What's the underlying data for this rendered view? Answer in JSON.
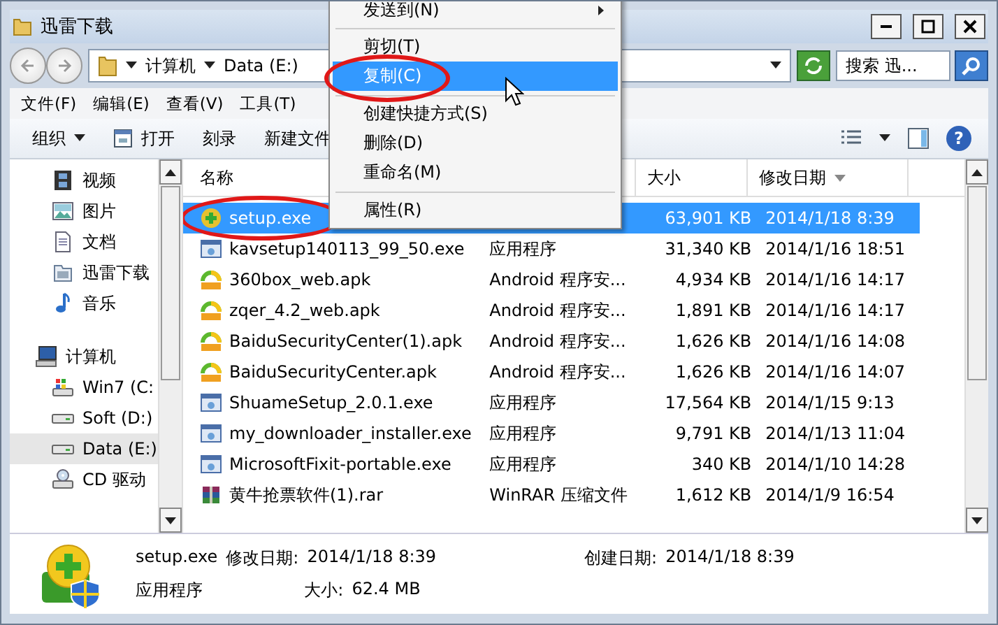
{
  "window": {
    "title": "迅雷下载"
  },
  "address_bar": {
    "path": [
      "计算机",
      "Data (E:)"
    ]
  },
  "search": {
    "placeholder": "搜索 迅..."
  },
  "menu_bar": [
    "文件(F)",
    "编辑(E)",
    "查看(V)",
    "工具(T)"
  ],
  "toolbar": [
    {
      "label": "组织",
      "kind": "dropdown"
    },
    {
      "label": "打开",
      "kind": "open"
    },
    {
      "label": "刻录",
      "kind": "plain"
    },
    {
      "label": "新建文件",
      "kind": "plain"
    }
  ],
  "help_button": {
    "label": "?"
  },
  "sidebar": {
    "items": [
      {
        "label": "视频",
        "kind": "video",
        "selected": false
      },
      {
        "label": "图片",
        "kind": "picture",
        "selected": false
      },
      {
        "label": "文档",
        "kind": "document",
        "selected": false
      },
      {
        "label": "迅雷下载",
        "kind": "folder",
        "selected": false
      },
      {
        "label": "音乐",
        "kind": "music",
        "selected": false
      },
      {
        "label": "计算机",
        "kind": "computer",
        "selected": false,
        "children": [
          {
            "label": "Win7 (C:",
            "kind": "system-drive",
            "selected": false
          },
          {
            "label": "Soft (D:)",
            "kind": "drive",
            "selected": false
          },
          {
            "label": "Data (E:)",
            "kind": "drive",
            "selected": true
          },
          {
            "label": "CD 驱动",
            "kind": "cd",
            "selected": false
          }
        ]
      }
    ]
  },
  "file_list": {
    "columns": [
      {
        "label": "名称",
        "sorted": false
      },
      {
        "label": "大小",
        "sorted": false
      },
      {
        "label": "修改日期",
        "sorted": true
      }
    ],
    "rows": [
      {
        "name": "setup.exe",
        "size": "63,901 KB",
        "modified": "2014/1/18 8:39",
        "kind": "setup",
        "selected": true,
        "highlighted": true
      },
      {
        "name": "kavsetup140113_99_50.exe",
        "type": "应用程序",
        "size": "31,340 KB",
        "modified": "2014/1/16 18:51",
        "kind": "exe",
        "selected": false,
        "highlighted": false
      },
      {
        "name": "360box_web.apk",
        "type": "Android 程序安...",
        "size": "4,934 KB",
        "modified": "2014/1/16 14:17",
        "kind": "apk",
        "selected": false,
        "highlighted": false
      },
      {
        "name": "zqer_4.2_web.apk",
        "type": "Android 程序安...",
        "size": "1,891 KB",
        "modified": "2014/1/16 14:17",
        "kind": "apk",
        "selected": false,
        "highlighted": false
      },
      {
        "name": "BaiduSecurityCenter(1).apk",
        "type": "Android 程序安...",
        "size": "1,626 KB",
        "modified": "2014/1/16 14:08",
        "kind": "apk",
        "selected": false,
        "highlighted": false
      },
      {
        "name": "BaiduSecurityCenter.apk",
        "type": "Android 程序安...",
        "size": "1,626 KB",
        "modified": "2014/1/16 14:07",
        "kind": "apk",
        "selected": false,
        "highlighted": false
      },
      {
        "name": "ShuameSetup_2.0.1.exe",
        "type": "应用程序",
        "size": "17,564 KB",
        "modified": "2014/1/15 9:13",
        "kind": "exe",
        "selected": false,
        "highlighted": false
      },
      {
        "name": "my_downloader_installer.exe",
        "type": "应用程序",
        "size": "9,791 KB",
        "modified": "2014/1/13 11:04",
        "kind": "exe",
        "selected": false,
        "highlighted": false
      },
      {
        "name": "MicrosoftFixit-portable.exe",
        "type": "应用程序",
        "size": "340 KB",
        "modified": "2014/1/10 14:28",
        "kind": "exe",
        "selected": false,
        "highlighted": false
      },
      {
        "name": "黄牛抢票软件(1).rar",
        "type": "WinRAR 压缩文件",
        "size": "1,612 KB",
        "modified": "2014/1/9 16:54",
        "kind": "rar",
        "selected": false,
        "highlighted": false
      }
    ]
  },
  "context_menu": {
    "items": [
      {
        "kind": "item",
        "label": "发送到(N)",
        "submenu": true,
        "selected": false,
        "highlighted": false
      },
      {
        "kind": "separator"
      },
      {
        "kind": "item",
        "label": "剪切(T)",
        "submenu": false,
        "selected": false,
        "highlighted": false
      },
      {
        "kind": "item",
        "label": "复制(C)",
        "submenu": false,
        "selected": true,
        "highlighted": true
      },
      {
        "kind": "separator"
      },
      {
        "kind": "item",
        "label": "创建快捷方式(S)",
        "submenu": false,
        "selected": false,
        "highlighted": false
      },
      {
        "kind": "item",
        "label": "删除(D)",
        "submenu": false,
        "selected": false,
        "highlighted": false
      },
      {
        "kind": "item",
        "label": "重命名(M)",
        "submenu": false,
        "selected": false,
        "highlighted": false
      },
      {
        "kind": "separator"
      },
      {
        "kind": "item",
        "label": "属性(R)",
        "submenu": false,
        "selected": false,
        "highlighted": false
      }
    ]
  },
  "details": {
    "name": "setup.exe",
    "type": "应用程序",
    "fields": [
      {
        "label": "修改日期:",
        "value": "2014/1/18 8:39"
      },
      {
        "label": "创建日期:",
        "value": "2014/1/18 8:39"
      },
      {
        "label": "大小:",
        "value": "62.4 MB"
      }
    ]
  }
}
